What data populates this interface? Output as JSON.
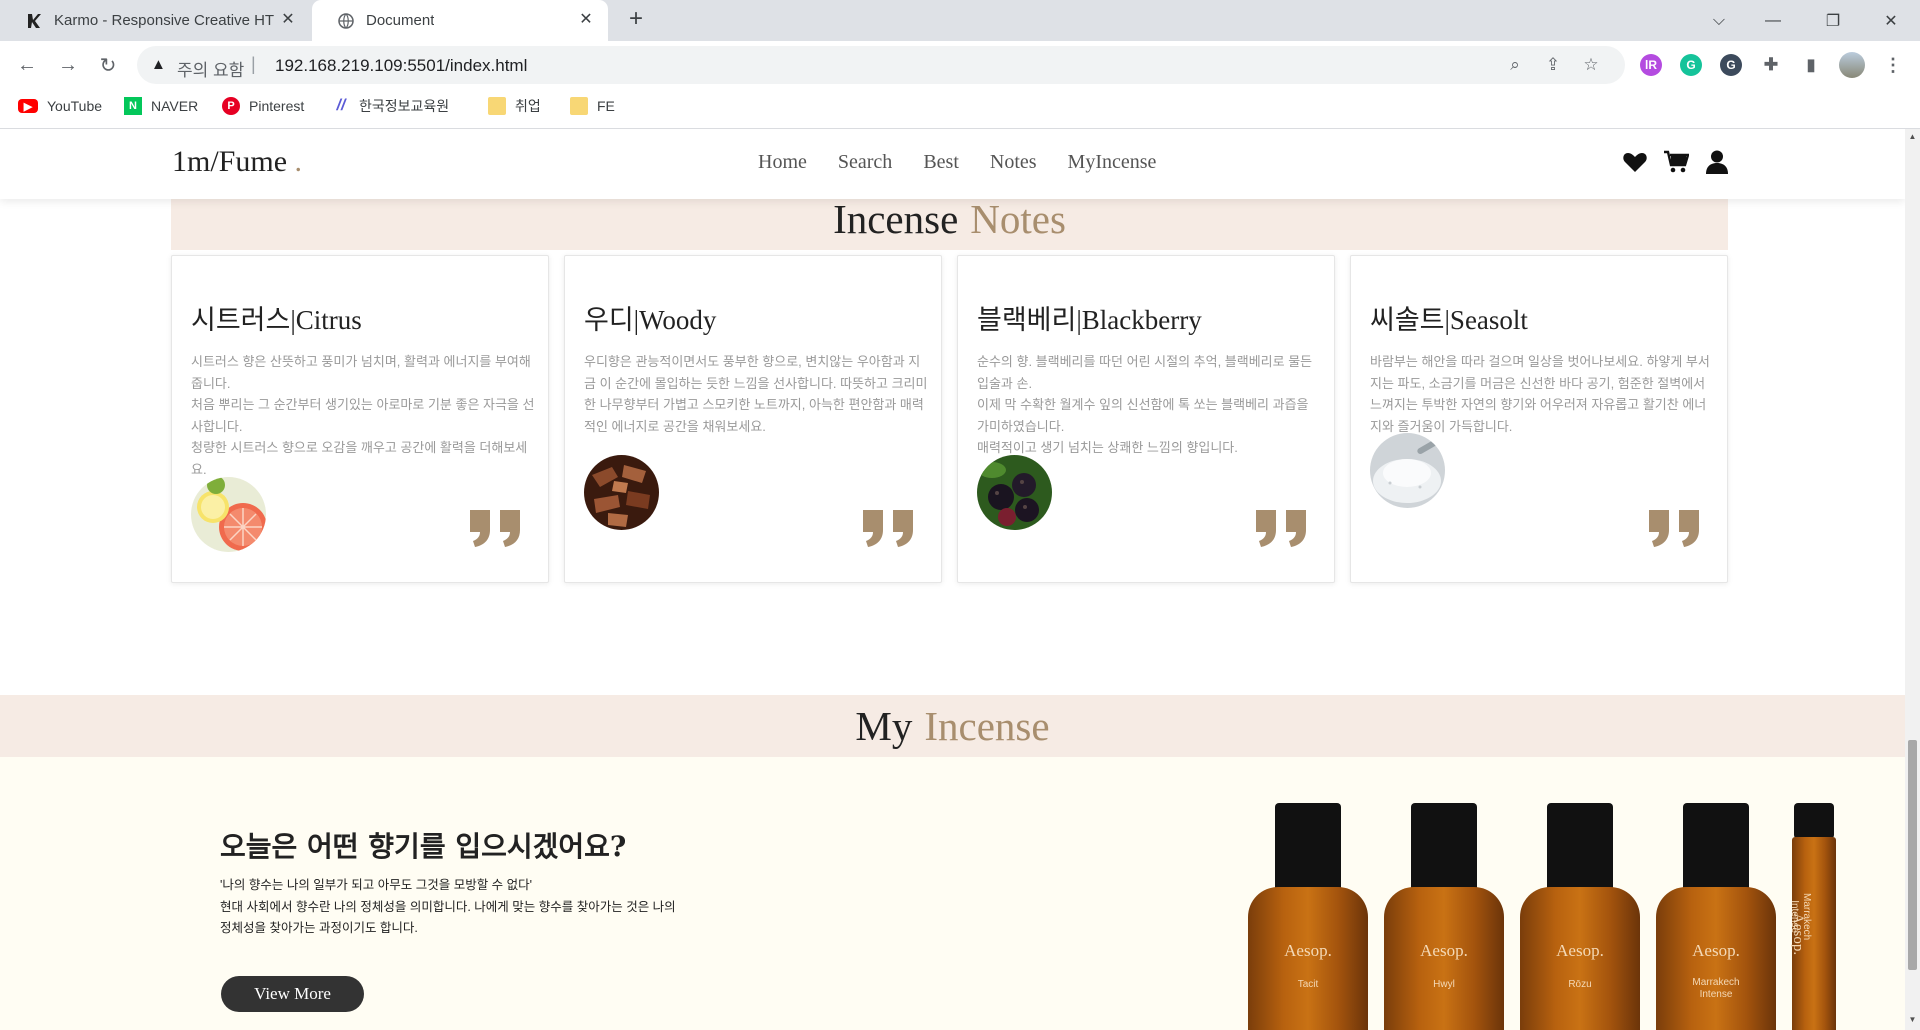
{
  "browser": {
    "tabs": [
      {
        "title": "Karmo - Responsive Creative HTML",
        "favicon": "karmo-logo-icon",
        "active": false
      },
      {
        "title": "Document",
        "favicon": "globe-icon",
        "active": true
      }
    ],
    "security_label": "주의 요함",
    "url_separator": "|",
    "url": "192.168.219.109:5501/index.html",
    "bookmarks": [
      {
        "label": "YouTube",
        "icon": "youtube-icon",
        "color": "#ff0000"
      },
      {
        "label": "NAVER",
        "icon": "naver-icon",
        "color": "#03c75a"
      },
      {
        "label": "Pinterest",
        "icon": "pinterest-icon",
        "color": "#e60023"
      },
      {
        "label": "한국정보교육원",
        "icon": "slash-logo-icon",
        "color": "#5b5bd6"
      },
      {
        "label": "취업",
        "icon": "folder-icon",
        "color": "#f8d775"
      },
      {
        "label": "FE",
        "icon": "folder-icon",
        "color": "#f8d775"
      }
    ]
  },
  "site": {
    "logo": {
      "text": "1m/Fume",
      "dot": "."
    },
    "menu": [
      "Home",
      "Search",
      "Best",
      "Notes",
      "MyIncense"
    ],
    "header_icons": [
      "heart-icon",
      "cart-icon",
      "user-icon"
    ],
    "accent_color": "#a88e6e",
    "band_color": "#f6ebe4"
  },
  "notes_section": {
    "title": "Incense",
    "title_accent": "Notes",
    "cards": [
      {
        "title": "시트러스|Citrus",
        "description": "시트러스 향은 산뜻하고 풍미가 넘치며, 활력과 에너지를 부여해 줍니다.\n처음 뿌리는 그 순간부터 생기있는 아로마로 기분 좋은 자극을 선사합니다.\n청량한 시트러스 향으로 오감을 깨우고 공간에 활력을 더해보세요.",
        "image": "citrus-fruit"
      },
      {
        "title": "우디|Woody",
        "description": "우디향은 관능적이면서도 풍부한 향으로, 변치않는 우아함과 지금 이 순간에 몰입하는 듯한 느낌을 선사합니다. 따뜻하고 크리미한 나무향부터 가볍고 스모키한 노트까지, 아늑한 편안함과 매력적인 에너지로 공간을 채워보세요.",
        "image": "wood-chips"
      },
      {
        "title": "블랙베리|Blackberry",
        "description": "순수의 향. 블랙베리를 따던 어린 시절의 추억, 블랙베리로 물든 입술과 손.\n이제 막 수확한 월계수 잎의 신선함에 톡 쏘는 블랙베리 과즙을 가미하였습니다.\n매력적이고 생기 넘치는 상쾌한 느낌의 향입니다.",
        "image": "blackberries"
      },
      {
        "title": "씨솔트|Seasolt",
        "description": "바람부는 해안을 따라 걸으며 일상을 벗어나보세요. 하얗게 부서지는 파도, 소금기를 머금은 신선한 바다 공기, 험준한 절벽에서 느껴지는 투박한 자연의 향기와 어우러져 자유롭고 활기찬 에너지와 즐거움이 가득합니다.",
        "image": "sea-salt"
      }
    ],
    "quote_icon": "quote-icon"
  },
  "my_incense": {
    "title": "My",
    "title_accent": "Incense",
    "heading": "오늘은 어떤 향기를 입으시겠어요?",
    "text": "'나의 향수는 나의 일부가 되고 아무도 그것을 모방할 수 없다'\n현대 사회에서 향수란 나의 정체성을 의미합니다. 나에게 맞는 향수를 찾아가는 것은 나의 정체성을 찾아가는 과정이기도 합니다.",
    "button": "View More",
    "products": [
      {
        "brand": "Aesop.",
        "name": "Tacit"
      },
      {
        "brand": "Aesop.",
        "name": "Hwyl"
      },
      {
        "brand": "Aesop.",
        "name": "Rōzu"
      },
      {
        "brand": "Aesop.",
        "name": "Marrakech\nIntense"
      },
      {
        "brand": "Aesop.",
        "name": "Marrakech\nIntense"
      }
    ]
  }
}
